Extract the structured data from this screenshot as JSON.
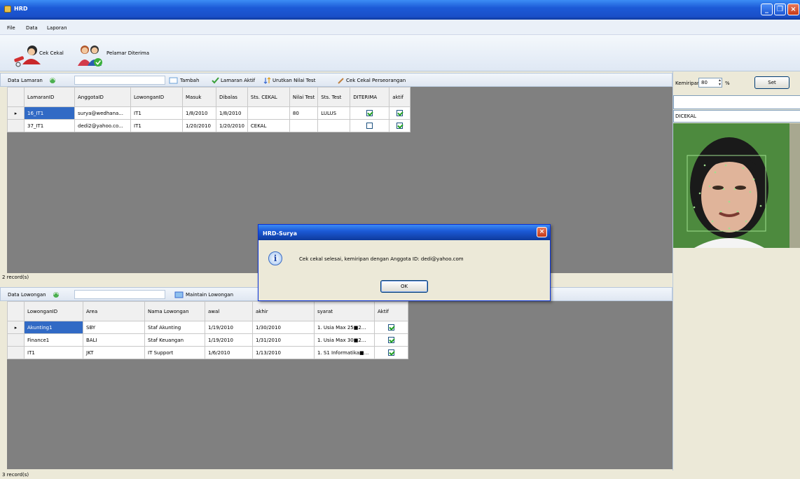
{
  "window": {
    "title": "HRD"
  },
  "menu": [
    "File",
    "Data",
    "Laporan"
  ],
  "toolbar": {
    "cek_cekal": "Cek Cekal",
    "pelamar_diterima": "Pelamar Diterima"
  },
  "lamaran_bar": {
    "label": "Data Lamaran",
    "tambah": "Tambah",
    "lamaran_aktif": "Lamaran Aktif",
    "urutkan": "Urutkan Nilai Test",
    "cek_perseorangan": "Cek Cekal Perseorangan"
  },
  "lamaran_table": {
    "columns": [
      "LamaranID",
      "AnggotaID",
      "LowonganID",
      "Masuk",
      "Dibalas",
      "Sts. CEKAL",
      "Nilai Test",
      "Sts. Test",
      "DITERIMA",
      "aktif"
    ],
    "rows": [
      {
        "id": "16_IT1",
        "anggota": "surya@wedhana...",
        "lowongan": "IT1",
        "masuk": "1/8/2010",
        "dibalas": "1/8/2010",
        "cekal": "",
        "nilai": "80",
        "sts_test": "LULUS",
        "diterima": true,
        "aktif": true
      },
      {
        "id": "37_IT1",
        "anggota": "dedi2@yahoo.co...",
        "lowongan": "IT1",
        "masuk": "1/20/2010",
        "dibalas": "1/20/2010",
        "cekal": "CEKAL",
        "nilai": "",
        "sts_test": "",
        "diterima": false,
        "aktif": true
      }
    ],
    "status": "2 record(s)"
  },
  "lowongan_bar": {
    "label": "Data Lowongan",
    "maintain": "Maintain Lowongan"
  },
  "lowongan_table": {
    "columns": [
      "LowonganID",
      "Area",
      "Nama Lowongan",
      "awal",
      "akhir",
      "syarat",
      "Aktif"
    ],
    "rows": [
      {
        "id": "Akunting1",
        "area": "SBY",
        "nama": "Staf Akunting",
        "awal": "1/19/2010",
        "akhir": "1/30/2010",
        "syarat": "1. Usia Max 25■2...",
        "aktif": true
      },
      {
        "id": "Finance1",
        "area": "BALI",
        "nama": "Staf Keuangan",
        "awal": "1/19/2010",
        "akhir": "1/31/2010",
        "syarat": "1. Usia Max 30■2...",
        "aktif": true
      },
      {
        "id": "IT1",
        "area": "JKT",
        "nama": "IT Support",
        "awal": "1/6/2010",
        "akhir": "1/13/2010",
        "syarat": "1. S1 Informatika■...",
        "aktif": true
      }
    ],
    "status": "3 record(s)"
  },
  "right_panel": {
    "kemiripan_label": "Kemiripan",
    "kemiripan_value": "80",
    "percent": "%",
    "set_button": "Set",
    "name_input": "",
    "status": "DICEKAL"
  },
  "dialog": {
    "title": "HRD-Surya",
    "message": "Cek cekal selesai, kemiripan dengan Anggota ID: dedi@yahoo.com",
    "ok": "OK"
  }
}
